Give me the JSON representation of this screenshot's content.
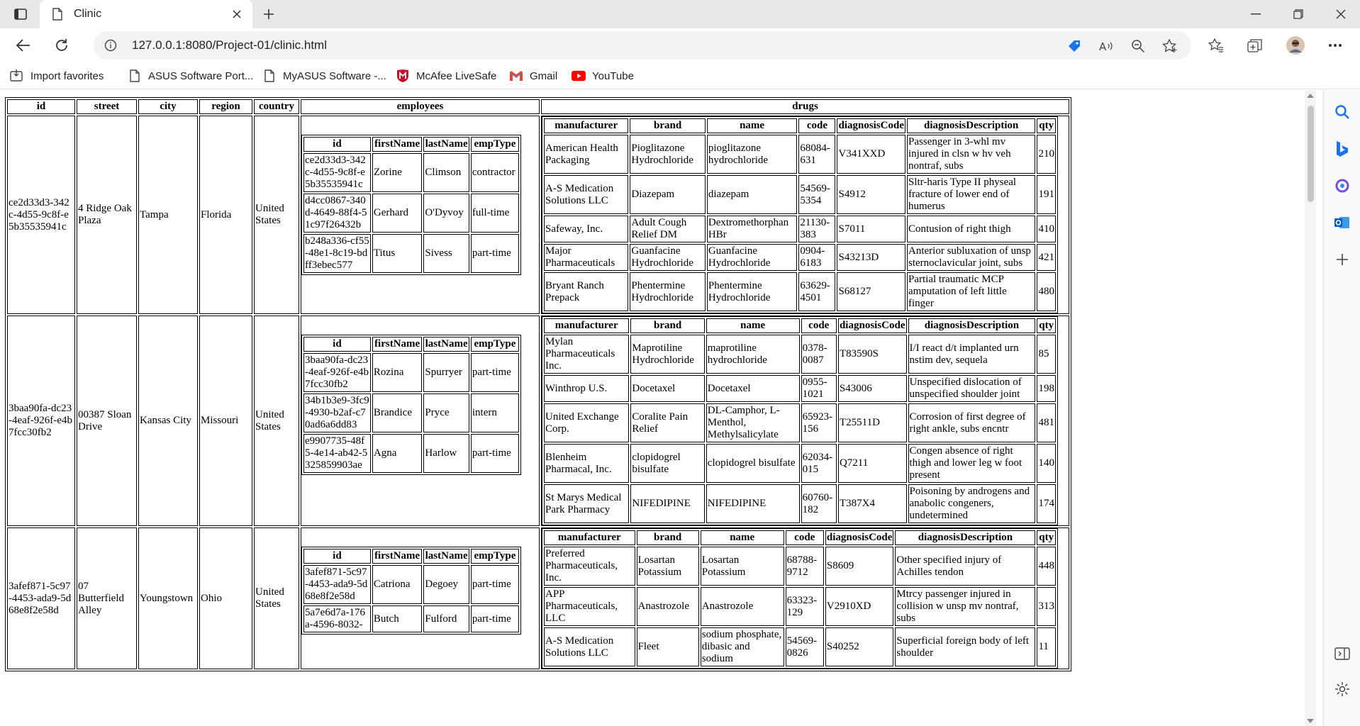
{
  "browser": {
    "tab_title": "Clinic",
    "url": "127.0.0.1:8080/Project-01/clinic.html",
    "bookmarks": [
      {
        "label": "Import favorites",
        "icon": "import-icon"
      },
      {
        "label": "ASUS Software Port...",
        "icon": "page-icon"
      },
      {
        "label": "MyASUS Software -...",
        "icon": "page-icon"
      },
      {
        "label": "McAfee LiveSafe",
        "icon": "mcafee-icon"
      },
      {
        "label": "Gmail",
        "icon": "gmail-icon"
      },
      {
        "label": "YouTube",
        "icon": "youtube-icon"
      }
    ]
  },
  "table": {
    "headers": {
      "id": "id",
      "street": "street",
      "city": "city",
      "region": "region",
      "country": "country",
      "employees": "employees",
      "drugs": "drugs"
    },
    "emp_headers": [
      "id",
      "firstName",
      "lastName",
      "empType"
    ],
    "drug_headers": [
      "manufacturer",
      "brand",
      "name",
      "code",
      "diagnosisCode",
      "diagnosisDescription",
      "qty"
    ],
    "clinics": [
      {
        "id": "ce2d33d3-342c-4d55-9c8f-e5b35535941c",
        "street": "4 Ridge Oak Plaza",
        "city": "Tampa",
        "region": "Florida",
        "country": "United States",
        "employees": [
          {
            "id": "ce2d33d3-342c-4d55-9c8f-e5b35535941c",
            "firstName": "Zorine",
            "lastName": "Climson",
            "empType": "contractor"
          },
          {
            "id": "d4cc0867-340d-4649-88f4-51c97f26432b",
            "firstName": "Gerhard",
            "lastName": "O'Dyvoy",
            "empType": "full-time"
          },
          {
            "id": "b248a336-cf55-48e1-8c19-bdff3ebec577",
            "firstName": "Titus",
            "lastName": "Sivess",
            "empType": "part-time"
          }
        ],
        "drugs": [
          {
            "manufacturer": "American Health Packaging",
            "brand": "Pioglitazone Hydrochloride",
            "name": "pioglitazone hydrochloride",
            "code": "68084-631",
            "diagnosisCode": "V341XXD",
            "diagnosisDescription": "Passenger in 3-whl mv injured in clsn w hv veh nontraf, subs",
            "qty": "210"
          },
          {
            "manufacturer": "A-S Medication Solutions LLC",
            "brand": "Diazepam",
            "name": "diazepam",
            "code": "54569-5354",
            "diagnosisCode": "S4912",
            "diagnosisDescription": "Sltr-haris Type II physeal fracture of lower end of humerus",
            "qty": "191"
          },
          {
            "manufacturer": "Safeway, Inc.",
            "brand": "Adult Cough Relief DM",
            "name": "Dextromethorphan HBr",
            "code": "21130-383",
            "diagnosisCode": "S7011",
            "diagnosisDescription": "Contusion of right thigh",
            "qty": "410"
          },
          {
            "manufacturer": "Major Pharmaceuticals",
            "brand": "Guanfacine Hydrochloride",
            "name": "Guanfacine Hydrochloride",
            "code": "0904-6183",
            "diagnosisCode": "S43213D",
            "diagnosisDescription": "Anterior subluxation of unsp sternoclavicular joint, subs",
            "qty": "421"
          },
          {
            "manufacturer": "Bryant Ranch Prepack",
            "brand": "Phentermine Hydrochloride",
            "name": "Phentermine Hydrochloride",
            "code": "63629-4501",
            "diagnosisCode": "S68127",
            "diagnosisDescription": "Partial traumatic MCP amputation of left little finger",
            "qty": "480"
          }
        ]
      },
      {
        "id": "3baa90fa-dc23-4eaf-926f-e4b7fcc30fb2",
        "street": "00387 Sloan Drive",
        "city": "Kansas City",
        "region": "Missouri",
        "country": "United States",
        "employees": [
          {
            "id": "3baa90fa-dc23-4eaf-926f-e4b7fcc30fb2",
            "firstName": "Rozina",
            "lastName": "Spurryer",
            "empType": "part-time"
          },
          {
            "id": "34b1b3e9-3fc9-4930-b2af-c70ad6a6dd83",
            "firstName": "Brandice",
            "lastName": "Pryce",
            "empType": "intern"
          },
          {
            "id": "e9907735-48f5-4e14-ab42-5325859903ae",
            "firstName": "Agna",
            "lastName": "Harlow",
            "empType": "part-time"
          }
        ],
        "drugs": [
          {
            "manufacturer": "Mylan Pharmaceuticals Inc.",
            "brand": "Maprotiline Hydrochloride",
            "name": "maprotiline hydrochloride",
            "code": "0378-0087",
            "diagnosisCode": "T83590S",
            "diagnosisDescription": "I/I react d/t implanted urn nstim dev, sequela",
            "qty": "85"
          },
          {
            "manufacturer": "Winthrop U.S.",
            "brand": "Docetaxel",
            "name": "Docetaxel",
            "code": "0955-1021",
            "diagnosisCode": "S43006",
            "diagnosisDescription": "Unspecified dislocation of unspecified shoulder joint",
            "qty": "198"
          },
          {
            "manufacturer": "United Exchange Corp.",
            "brand": "Coralite Pain Relief",
            "name": "DL-Camphor, L-Menthol, Methylsalicylate",
            "code": "65923-156",
            "diagnosisCode": "T25511D",
            "diagnosisDescription": "Corrosion of first degree of right ankle, subs encntr",
            "qty": "481"
          },
          {
            "manufacturer": "Blenheim Pharmacal, Inc.",
            "brand": "clopidogrel bisulfate",
            "name": "clopidogrel bisulfate",
            "code": "62034-015",
            "diagnosisCode": "Q7211",
            "diagnosisDescription": "Congen absence of right thigh and lower leg w foot present",
            "qty": "140"
          },
          {
            "manufacturer": "St Marys Medical Park Pharmacy",
            "brand": "NIFEDIPINE",
            "name": "NIFEDIPINE",
            "code": "60760-182",
            "diagnosisCode": "T387X4",
            "diagnosisDescription": "Poisoning by androgens and anabolic congeners, undetermined",
            "qty": "174"
          }
        ]
      },
      {
        "id": "3afef871-5c97-4453-ada9-5d68e8f2e58d",
        "street": "07 Butterfield Alley",
        "city": "Youngstown",
        "region": "Ohio",
        "country": "United States",
        "employees": [
          {
            "id": "3afef871-5c97-4453-ada9-5d68e8f2e58d",
            "firstName": "Catriona",
            "lastName": "Degoey",
            "empType": "part-time"
          },
          {
            "id": "5a7e6d7a-176a-4596-8032-",
            "firstName": "Butch",
            "lastName": "Fulford",
            "empType": "part-time"
          }
        ],
        "drugs": [
          {
            "manufacturer": "Preferred Pharmaceuticals, Inc.",
            "brand": "Losartan Potassium",
            "name": "Losartan Potassium",
            "code": "68788-9712",
            "diagnosisCode": "S8609",
            "diagnosisDescription": "Other specified injury of Achilles tendon",
            "qty": "448"
          },
          {
            "manufacturer": "APP Pharmaceuticals, LLC",
            "brand": "Anastrozole",
            "name": "Anastrozole",
            "code": "63323-129",
            "diagnosisCode": "V2910XD",
            "diagnosisDescription": "Mtrcy passenger injured in collision w unsp mv nontraf, subs",
            "qty": "313"
          },
          {
            "manufacturer": "A-S Medication Solutions LLC",
            "brand": "Fleet",
            "name": "sodium phosphate, dibasic and sodium",
            "code": "54569-0826",
            "diagnosisCode": "S40252",
            "diagnosisDescription": "Superficial foreign body of left shoulder",
            "qty": "11"
          }
        ]
      }
    ]
  }
}
